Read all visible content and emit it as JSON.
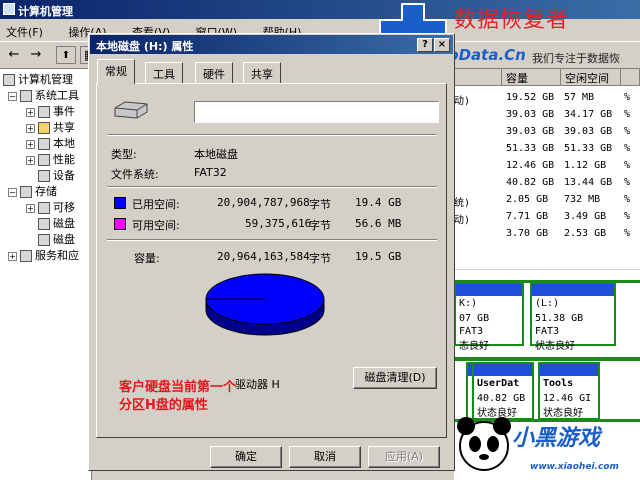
{
  "main_window": {
    "title": "计算机管理",
    "menu": [
      "文件(F)",
      "操作(A)",
      "查看(V)",
      "窗口(W)",
      "帮助(H)"
    ]
  },
  "tree": {
    "items": [
      {
        "label": "计算机管理",
        "expander": ""
      },
      {
        "label": "系统工具",
        "expander": "−"
      },
      {
        "label": "事件",
        "expander": "+"
      },
      {
        "label": "共享",
        "expander": "+"
      },
      {
        "label": "本地",
        "expander": "+"
      },
      {
        "label": "性能",
        "expander": "+"
      },
      {
        "label": "设备",
        "expander": ""
      },
      {
        "label": "存储",
        "expander": "−"
      },
      {
        "label": "可移",
        "expander": "+"
      },
      {
        "label": "磁盘",
        "expander": ""
      },
      {
        "label": "磁盘",
        "expander": ""
      },
      {
        "label": "服务和应",
        "expander": "+"
      }
    ]
  },
  "volume_list": {
    "headers": [
      "容量",
      "空闲空间"
    ],
    "rows": [
      {
        "status": "动)",
        "capacity": "19.52 GB",
        "free": "57 MB"
      },
      {
        "status": "",
        "capacity": "39.03 GB",
        "free": "34.17 GB"
      },
      {
        "status": "",
        "capacity": "39.03 GB",
        "free": "39.03 GB"
      },
      {
        "status": "",
        "capacity": "51.33 GB",
        "free": "51.33 GB"
      },
      {
        "status": "",
        "capacity": "12.46 GB",
        "free": "1.12 GB"
      },
      {
        "status": "",
        "capacity": "40.82 GB",
        "free": "13.44 GB"
      },
      {
        "status": "统)",
        "capacity": "2.05 GB",
        "free": "732 MB"
      },
      {
        "status": "动)",
        "capacity": "7.71 GB",
        "free": "3.49 GB"
      },
      {
        "status": "",
        "capacity": "3.70 GB",
        "free": "2.53 GB"
      }
    ]
  },
  "disk_map": {
    "volumes": [
      {
        "name": "K:)",
        "size": "07 GB FAT3",
        "state": "态良好"
      },
      {
        "name": "(L:)",
        "size": "51.38 GB FAT3",
        "state": "状态良好"
      },
      {
        "name": "UserDat",
        "size": "40.82 GB",
        "state": "状态良好"
      },
      {
        "name": "Tools",
        "size": "12.46 GI",
        "state": "状态良好"
      }
    ]
  },
  "dialog": {
    "title": "本地磁盘 (H:) 属性",
    "tabs": [
      "常规",
      "工具",
      "硬件",
      "共享"
    ],
    "volume_name": "",
    "type_label": "类型:",
    "type_value": "本地磁盘",
    "fs_label": "文件系统:",
    "fs_value": "FAT32",
    "used": {
      "label": "已用空间:",
      "bytes": "20,904,787,968",
      "unit": "字节",
      "size": "19.4 GB",
      "color": "#0000ff"
    },
    "free": {
      "label": "可用空间:",
      "bytes": "59,375,616",
      "unit": "字节",
      "size": "56.6 MB",
      "color": "#ff00ff"
    },
    "capacity": {
      "label": "容量:",
      "bytes": "20,964,163,584",
      "unit": "字节",
      "size": "19.5 GB"
    },
    "drive_label": "驱动器 H",
    "cleanup_button": "磁盘清理(D)",
    "buttons": {
      "ok": "确定",
      "cancel": "取消",
      "apply": "应用(A)"
    },
    "note_line1": "客户硬盘当前第一个",
    "note_line2": "分区H盘的属性"
  },
  "watermark": {
    "brand_cn": "数据恢复者",
    "site": "HelpData.Cn",
    "slogan": "我们专注于数据恢",
    "footer_site": "www.xiaohei.com",
    "footer_logo": "小黑游戏"
  },
  "colors": {
    "title_bar": "#0a246a",
    "used": "#0000ff",
    "free": "#ff00ff",
    "volume_bar": "#1f4fd8",
    "note": "#e8141e"
  }
}
